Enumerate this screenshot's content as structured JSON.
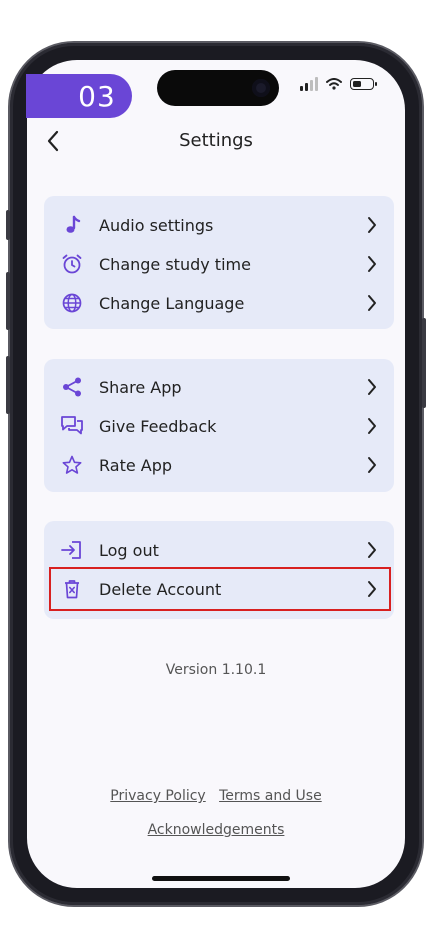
{
  "step_badge": "03",
  "header": {
    "title": "Settings"
  },
  "groups": [
    {
      "items": [
        {
          "label": "Audio settings",
          "icon": "music-note-icon"
        },
        {
          "label": "Change study time",
          "icon": "alarm-clock-icon"
        },
        {
          "label": "Change Language",
          "icon": "globe-icon"
        }
      ]
    },
    {
      "items": [
        {
          "label": "Share App",
          "icon": "share-icon"
        },
        {
          "label": "Give Feedback",
          "icon": "feedback-chat-icon"
        },
        {
          "label": "Rate App",
          "icon": "star-icon"
        }
      ]
    },
    {
      "items": [
        {
          "label": "Log out",
          "icon": "logout-icon"
        },
        {
          "label": "Delete Account",
          "icon": "trash-icon"
        }
      ]
    }
  ],
  "version": "Version 1.10.1",
  "footer": {
    "privacy": "Privacy Policy",
    "terms": "Terms and Use",
    "acknowledgements": "Acknowledgements"
  },
  "colors": {
    "accent": "#6a46d6",
    "card_bg": "#e6eaf8",
    "highlight": "#d82020"
  }
}
